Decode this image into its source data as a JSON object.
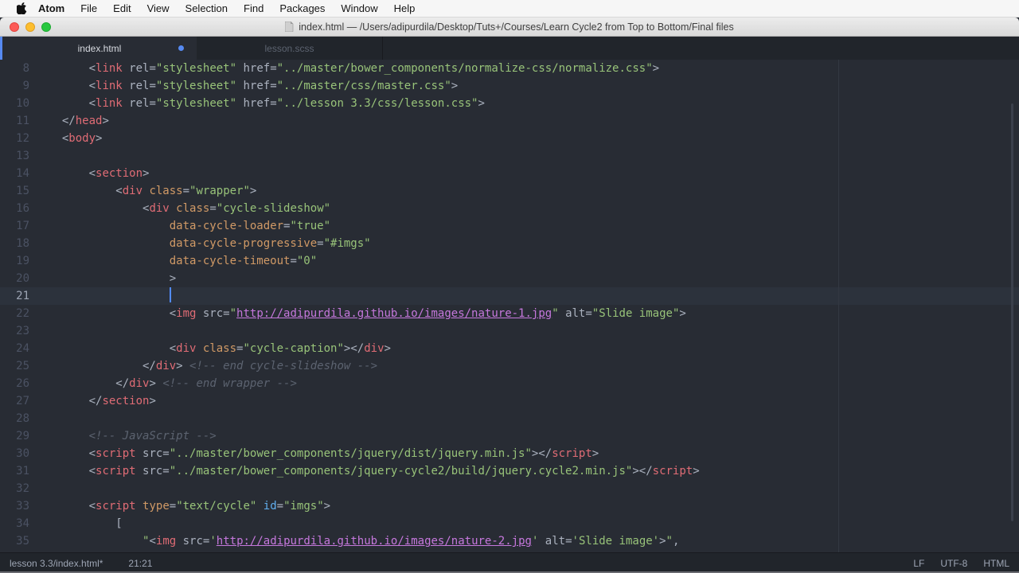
{
  "menu_bar": {
    "items": [
      "Atom",
      "File",
      "Edit",
      "View",
      "Selection",
      "Find",
      "Packages",
      "Window",
      "Help"
    ]
  },
  "title_bar": {
    "title": "index.html — /Users/adipurdila/Desktop/Tuts+/Courses/Learn Cycle2 from Top to Bottom/Final files"
  },
  "tabs": [
    {
      "label": "index.html",
      "active": true,
      "modified": true
    },
    {
      "label": "lesson.scss",
      "active": false,
      "modified": false
    }
  ],
  "editor": {
    "language": "HTML",
    "active_line": 21,
    "cursor_position": "21:21",
    "token_legend": {
      "p": "plain",
      "t": "tag",
      "a": "attribute",
      "i": "id-attribute",
      "s": "string",
      "u": "url-link",
      "c": "comment"
    },
    "lines": [
      {
        "n": 8,
        "tokens": [
          [
            "p",
            "      <"
          ],
          [
            "t",
            "link"
          ],
          [
            "p",
            " rel="
          ],
          [
            "s",
            "\"stylesheet\""
          ],
          [
            "p",
            " href="
          ],
          [
            "s",
            "\"../master/bower_components/normalize-css/normalize.css\""
          ],
          [
            "p",
            ">"
          ]
        ]
      },
      {
        "n": 9,
        "tokens": [
          [
            "p",
            "      <"
          ],
          [
            "t",
            "link"
          ],
          [
            "p",
            " rel="
          ],
          [
            "s",
            "\"stylesheet\""
          ],
          [
            "p",
            " href="
          ],
          [
            "s",
            "\"../master/css/master.css\""
          ],
          [
            "p",
            ">"
          ]
        ]
      },
      {
        "n": 10,
        "tokens": [
          [
            "p",
            "      <"
          ],
          [
            "t",
            "link"
          ],
          [
            "p",
            " rel="
          ],
          [
            "s",
            "\"stylesheet\""
          ],
          [
            "p",
            " href="
          ],
          [
            "s",
            "\"../lesson 3.3/css/lesson.css\""
          ],
          [
            "p",
            ">"
          ]
        ]
      },
      {
        "n": 11,
        "tokens": [
          [
            "p",
            "  </"
          ],
          [
            "t",
            "head"
          ],
          [
            "p",
            ">"
          ]
        ]
      },
      {
        "n": 12,
        "tokens": [
          [
            "p",
            "  <"
          ],
          [
            "t",
            "body"
          ],
          [
            "p",
            ">"
          ]
        ]
      },
      {
        "n": 13,
        "tokens": []
      },
      {
        "n": 14,
        "tokens": [
          [
            "p",
            "      <"
          ],
          [
            "t",
            "section"
          ],
          [
            "p",
            ">"
          ]
        ]
      },
      {
        "n": 15,
        "tokens": [
          [
            "p",
            "          <"
          ],
          [
            "t",
            "div"
          ],
          [
            "p",
            " "
          ],
          [
            "a",
            "class"
          ],
          [
            "p",
            "="
          ],
          [
            "s",
            "\"wrapper\""
          ],
          [
            "p",
            ">"
          ]
        ]
      },
      {
        "n": 16,
        "tokens": [
          [
            "p",
            "              <"
          ],
          [
            "t",
            "div"
          ],
          [
            "p",
            " "
          ],
          [
            "a",
            "class"
          ],
          [
            "p",
            "="
          ],
          [
            "s",
            "\"cycle-slideshow\""
          ]
        ]
      },
      {
        "n": 17,
        "tokens": [
          [
            "p",
            "                  "
          ],
          [
            "a",
            "data-cycle-loader"
          ],
          [
            "p",
            "="
          ],
          [
            "s",
            "\"true\""
          ]
        ]
      },
      {
        "n": 18,
        "tokens": [
          [
            "p",
            "                  "
          ],
          [
            "a",
            "data-cycle-progressive"
          ],
          [
            "p",
            "="
          ],
          [
            "s",
            "\"#imgs\""
          ]
        ]
      },
      {
        "n": 19,
        "tokens": [
          [
            "p",
            "                  "
          ],
          [
            "a",
            "data-cycle-timeout"
          ],
          [
            "p",
            "="
          ],
          [
            "s",
            "\"0\""
          ]
        ]
      },
      {
        "n": 20,
        "tokens": [
          [
            "p",
            "                  >"
          ]
        ]
      },
      {
        "n": 21,
        "tokens": [
          [
            "p",
            "                  "
          ]
        ],
        "cursor": true
      },
      {
        "n": 22,
        "tokens": [
          [
            "p",
            "                  <"
          ],
          [
            "t",
            "img"
          ],
          [
            "p",
            " src="
          ],
          [
            "s",
            "\""
          ],
          [
            "u",
            "http://adipurdila.github.io/images/nature-1.jpg"
          ],
          [
            "s",
            "\""
          ],
          [
            "p",
            " alt="
          ],
          [
            "s",
            "\"Slide image\""
          ],
          [
            "p",
            ">"
          ]
        ]
      },
      {
        "n": 23,
        "tokens": []
      },
      {
        "n": 24,
        "tokens": [
          [
            "p",
            "                  <"
          ],
          [
            "t",
            "div"
          ],
          [
            "p",
            " "
          ],
          [
            "a",
            "class"
          ],
          [
            "p",
            "="
          ],
          [
            "s",
            "\"cycle-caption\""
          ],
          [
            "p",
            "></"
          ],
          [
            "t",
            "div"
          ],
          [
            "p",
            ">"
          ]
        ]
      },
      {
        "n": 25,
        "tokens": [
          [
            "p",
            "              </"
          ],
          [
            "t",
            "div"
          ],
          [
            "p",
            ">"
          ],
          [
            "c",
            " <!-- end cycle-slideshow -->"
          ]
        ]
      },
      {
        "n": 26,
        "tokens": [
          [
            "p",
            "          </"
          ],
          [
            "t",
            "div"
          ],
          [
            "p",
            ">"
          ],
          [
            "c",
            " <!-- end wrapper -->"
          ]
        ]
      },
      {
        "n": 27,
        "tokens": [
          [
            "p",
            "      </"
          ],
          [
            "t",
            "section"
          ],
          [
            "p",
            ">"
          ]
        ]
      },
      {
        "n": 28,
        "tokens": []
      },
      {
        "n": 29,
        "tokens": [
          [
            "c",
            "      <!-- JavaScript -->"
          ]
        ]
      },
      {
        "n": 30,
        "tokens": [
          [
            "p",
            "      <"
          ],
          [
            "t",
            "script"
          ],
          [
            "p",
            " src="
          ],
          [
            "s",
            "\"../master/bower_components/jquery/dist/jquery.min.js\""
          ],
          [
            "p",
            "></"
          ],
          [
            "t",
            "script"
          ],
          [
            "p",
            ">"
          ]
        ]
      },
      {
        "n": 31,
        "tokens": [
          [
            "p",
            "      <"
          ],
          [
            "t",
            "script"
          ],
          [
            "p",
            " src="
          ],
          [
            "s",
            "\"../master/bower_components/jquery-cycle2/build/jquery.cycle2.min.js\""
          ],
          [
            "p",
            "></"
          ],
          [
            "t",
            "script"
          ],
          [
            "p",
            ">"
          ]
        ]
      },
      {
        "n": 32,
        "tokens": []
      },
      {
        "n": 33,
        "tokens": [
          [
            "p",
            "      <"
          ],
          [
            "t",
            "script"
          ],
          [
            "p",
            " "
          ],
          [
            "a",
            "type"
          ],
          [
            "p",
            "="
          ],
          [
            "s",
            "\"text/cycle\""
          ],
          [
            "p",
            " "
          ],
          [
            "i",
            "id"
          ],
          [
            "p",
            "="
          ],
          [
            "s",
            "\"imgs\""
          ],
          [
            "p",
            ">"
          ]
        ]
      },
      {
        "n": 34,
        "tokens": [
          [
            "p",
            "          ["
          ]
        ]
      },
      {
        "n": 35,
        "tokens": [
          [
            "p",
            "              "
          ],
          [
            "s",
            "\""
          ],
          [
            "p",
            "<"
          ],
          [
            "t",
            "img"
          ],
          [
            "p",
            " src="
          ],
          [
            "s",
            "'"
          ],
          [
            "u",
            "http://adipurdila.github.io/images/nature-2.jpg"
          ],
          [
            "s",
            "'"
          ],
          [
            "p",
            " alt="
          ],
          [
            "s",
            "'Slide image'"
          ],
          [
            "p",
            ">"
          ],
          [
            "s",
            "\""
          ],
          [
            "p",
            ","
          ]
        ]
      }
    ]
  },
  "status_bar": {
    "file": "lesson 3.3/index.html*",
    "position": "21:21",
    "right": [
      "LF",
      "UTF-8",
      "HTML"
    ]
  },
  "colors": {
    "accent_blue": "#568af2",
    "cursor_blue": "#528bff",
    "editor_bg": "#282c34",
    "chrome_bg": "#21252b",
    "syntax_tag": "#e06c75",
    "syntax_attr": "#d19a66",
    "syntax_id_attr": "#61afef",
    "syntax_string": "#98c379",
    "syntax_url": "#c678dd",
    "syntax_comment": "#5c6370",
    "syntax_plain": "#abb2bf",
    "traffic_red": "#fc5b57",
    "traffic_yellow": "#fdbe2e",
    "traffic_green": "#28c840"
  }
}
